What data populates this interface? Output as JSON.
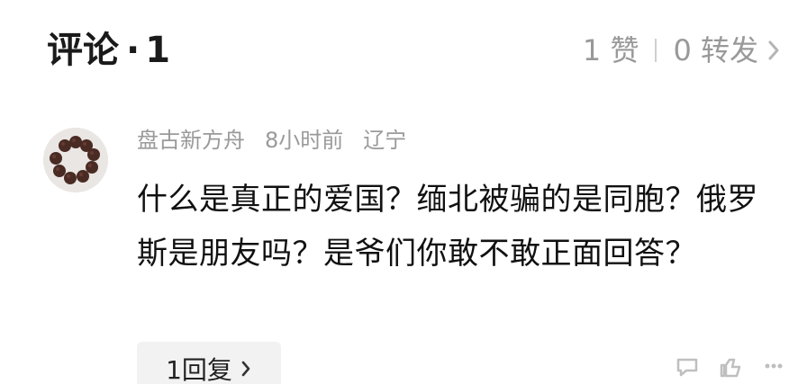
{
  "header": {
    "title": "评论",
    "dot": "·",
    "count": "1",
    "likes_label": "1 赞",
    "forwards_label": "0 转发",
    "icons": {
      "chevron": "chevron-right-icon"
    }
  },
  "comment": {
    "username": "盘古新方舟",
    "time": "8小时前",
    "location": "辽宁",
    "text": "什么是真正的爱国？缅北被骗的是同胞？俄罗斯是朋友吗？是爷们你敢不敢正面回答？",
    "reply_button_label": "1回复",
    "icons": {
      "avatar": "prayer-beads-avatar-icon",
      "reply_chevron": "chevron-right-icon",
      "bottom_1": "comment-icon",
      "bottom_2": "like-icon",
      "bottom_3": "more-icon"
    }
  },
  "colors": {
    "text_primary": "#111111",
    "text_secondary": "#9a9a9a",
    "chip_bg": "#f2f2f2",
    "avatar_bg": "#e9e6e3",
    "bead": "#4a2b24"
  }
}
